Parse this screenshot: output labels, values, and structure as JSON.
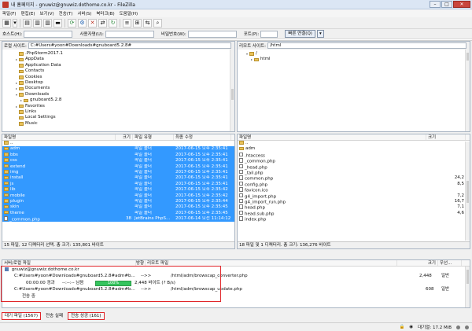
{
  "window": {
    "title": "내 홈페이지 - gnuwiz@gnuwiz.dothome.co.kr - FileZilla"
  },
  "menu": [
    "파일(F)",
    "편집(E)",
    "보기(V)",
    "전송(T)",
    "서버(S)",
    "북마크(B)",
    "도움말(H)"
  ],
  "quickconnect": {
    "host_label": "호스트(H):",
    "user_label": "사용자명(U):",
    "pass_label": "비밀번호(W):",
    "port_label": "포트(P):",
    "button": "빠른 연결(Q)",
    "dropdown": "▾"
  },
  "local": {
    "site_label": "로컬 사이트:",
    "path": "C:#Users#yoon#Downloads#gnuboard5.2.8#",
    "tree": [
      {
        "label": ".PhpStorm2017.1",
        "indent": 2,
        "exp": "",
        "icon": "folder"
      },
      {
        "label": "AppData",
        "indent": 2,
        "exp": "▸",
        "icon": "folder"
      },
      {
        "label": "Application Data",
        "indent": 2,
        "exp": "",
        "icon": "folder"
      },
      {
        "label": "Contacts",
        "indent": 2,
        "exp": "",
        "icon": "folder"
      },
      {
        "label": "Cookies",
        "indent": 2,
        "exp": "",
        "icon": "folder"
      },
      {
        "label": "Desktop",
        "indent": 2,
        "exp": "▸",
        "icon": "folder"
      },
      {
        "label": "Documents",
        "indent": 2,
        "exp": "▸",
        "icon": "folder"
      },
      {
        "label": "Downloads",
        "indent": 2,
        "exp": "▾",
        "icon": "folder"
      },
      {
        "label": "gnuboard5.2.8",
        "indent": 3,
        "exp": "▸",
        "icon": "folder"
      },
      {
        "label": "Favorites",
        "indent": 2,
        "exp": "▸",
        "icon": "folder"
      },
      {
        "label": "Links",
        "indent": 2,
        "exp": "",
        "icon": "folder"
      },
      {
        "label": "Local Settings",
        "indent": 2,
        "exp": "",
        "icon": "folder"
      },
      {
        "label": "Music",
        "indent": 2,
        "exp": "",
        "icon": "folder"
      }
    ],
    "headers": [
      "파일명",
      "크기",
      "파일 유형",
      "최종 수정"
    ],
    "rows": [
      {
        "name": "..",
        "size": "",
        "type": "",
        "date": "",
        "sel": false,
        "icon": "folder"
      },
      {
        "name": "adm",
        "size": "",
        "type": "파일 폴더",
        "date": "2017-06-15 오후 2:35:41",
        "sel": true,
        "icon": "folder"
      },
      {
        "name": "bbs",
        "size": "",
        "type": "파일 폴더",
        "date": "2017-06-15 오후 2:35:41",
        "sel": true,
        "icon": "folder"
      },
      {
        "name": "css",
        "size": "",
        "type": "파일 폴더",
        "date": "2017-06-15 오후 2:35:41",
        "sel": true,
        "icon": "folder"
      },
      {
        "name": "extend",
        "size": "",
        "type": "파일 폴더",
        "date": "2017-06-15 오후 2:35:41",
        "sel": true,
        "icon": "folder"
      },
      {
        "name": "img",
        "size": "",
        "type": "파일 폴더",
        "date": "2017-06-15 오후 2:35:41",
        "sel": true,
        "icon": "folder"
      },
      {
        "name": "install",
        "size": "",
        "type": "파일 폴더",
        "date": "2017-06-15 오후 2:35:41",
        "sel": true,
        "icon": "folder"
      },
      {
        "name": "js",
        "size": "",
        "type": "파일 폴더",
        "date": "2017-06-15 오후 2:35:41",
        "sel": true,
        "icon": "folder"
      },
      {
        "name": "lib",
        "size": "",
        "type": "파일 폴더",
        "date": "2017-06-15 오후 2:35:42",
        "sel": true,
        "icon": "folder"
      },
      {
        "name": "mobile",
        "size": "",
        "type": "파일 폴더",
        "date": "2017-06-15 오후 2:35:42",
        "sel": true,
        "icon": "folder"
      },
      {
        "name": "plugin",
        "size": "",
        "type": "파일 폴더",
        "date": "2017-06-15 오후 2:35:44",
        "sel": true,
        "icon": "folder"
      },
      {
        "name": "skin",
        "size": "",
        "type": "파일 폴더",
        "date": "2017-06-15 오후 2:35:45",
        "sel": true,
        "icon": "folder"
      },
      {
        "name": "theme",
        "size": "",
        "type": "파일 폴더",
        "date": "2017-06-15 오후 2:35:45",
        "sel": true,
        "icon": "folder"
      },
      {
        "name": "_common.php",
        "size": "38",
        "type": "JetBrains PhpS...",
        "date": "2017-06-14 오전 11:14:12",
        "sel": true,
        "icon": "file"
      }
    ],
    "status": "15 파일, 12 디렉터리 선택. 총 크기: 135,801 바이트"
  },
  "remote": {
    "site_label": "리모트 사이트:",
    "path": "/html",
    "tree": [
      {
        "label": "/",
        "indent": 1,
        "exp": "▾",
        "icon": "folder"
      },
      {
        "label": "html",
        "indent": 2,
        "exp": "▸",
        "icon": "folder"
      }
    ],
    "headers": [
      "파일명",
      "크기"
    ],
    "rows": [
      {
        "name": "..",
        "size": "",
        "icon": "folder"
      },
      {
        "name": "adm",
        "size": "",
        "icon": "folder"
      },
      {
        "name": ".htaccess",
        "size": "",
        "icon": "file"
      },
      {
        "name": "_common.php",
        "size": "",
        "icon": "file"
      },
      {
        "name": "_head.php",
        "size": "",
        "icon": "file"
      },
      {
        "name": "_tail.php",
        "size": "",
        "icon": "file"
      },
      {
        "name": "common.php",
        "size": "24,2",
        "icon": "file"
      },
      {
        "name": "config.php",
        "size": "8,5",
        "icon": "file"
      },
      {
        "name": "favicon.ico",
        "size": "",
        "icon": "file"
      },
      {
        "name": "g4_import.php",
        "size": "7,2",
        "icon": "file"
      },
      {
        "name": "g4_import_run.php",
        "size": "16,7",
        "icon": "file"
      },
      {
        "name": "head.php",
        "size": "7,1",
        "icon": "file"
      },
      {
        "name": "head.sub.php",
        "size": "4,6",
        "icon": "file"
      },
      {
        "name": "index.php",
        "size": "",
        "icon": "file"
      }
    ],
    "status": "18 파일 및 1 디렉터리. 총 크기: 136,276 바이트"
  },
  "queue": {
    "headers": [
      "서버/로컬 파일",
      "방향",
      "리모트 파일",
      "크기",
      "우선..."
    ],
    "server": "gnuwiz@gnuwiz.dothome.co.kr",
    "item1_local": "C:#Users#yoon#Downloads#gnuboard5.2.8#adm#b...",
    "item1_dir": "-->>",
    "item1_remote": "/html/adm/browscap_converter.php",
    "item1_size": "2,448",
    "item1_prio": "일반",
    "progress_elapsed": "00:00:00 경과",
    "progress_left": "--:--:-- 남음",
    "progress_pct": "100%",
    "progress_bytes": "2,448 바이트 (? B/s)",
    "item2_local": "C:#Users#yoon#Downloads#gnuboard5.2.8#adm#b...",
    "item2_dir": "-->>",
    "item2_remote": "/html/adm/browscap_update.php",
    "item2_size": "608",
    "item2_prio": "일반",
    "status_text": "전송 중"
  },
  "tabs": [
    "대기 파일 (1567)",
    "전송 실패",
    "전송 성공 (161)"
  ],
  "bottom": {
    "queue_label": "대기열: 17.2 MiB"
  }
}
